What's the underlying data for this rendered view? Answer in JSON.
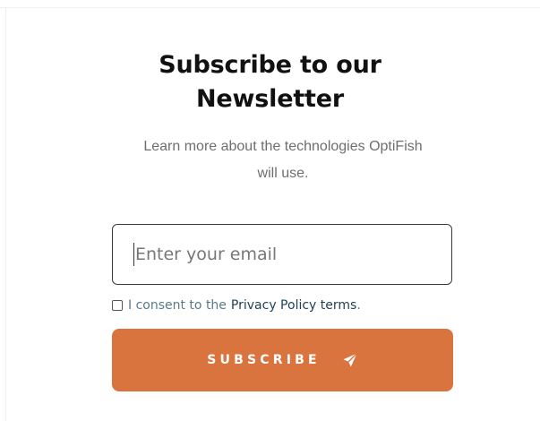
{
  "newsletter": {
    "title_line1": "Subscribe to our",
    "title_line2": "Newsletter",
    "subtitle_line1": "Learn more about the technologies OptiFish",
    "subtitle_line2": "will use.",
    "email_placeholder": "Enter your email",
    "email_value": "",
    "consent_prefix": "I consent to the",
    "consent_link": "Privacy Policy terms",
    "consent_suffix": ".",
    "consent_checked": false,
    "button_label": "SUBSCRIBE",
    "button_icon": "send-icon",
    "colors": {
      "button": "#d9743e",
      "title": "#111111",
      "subtitle": "#6e6e6e",
      "consent_text": "#5a7a8a",
      "link": "#1e3f55"
    }
  }
}
